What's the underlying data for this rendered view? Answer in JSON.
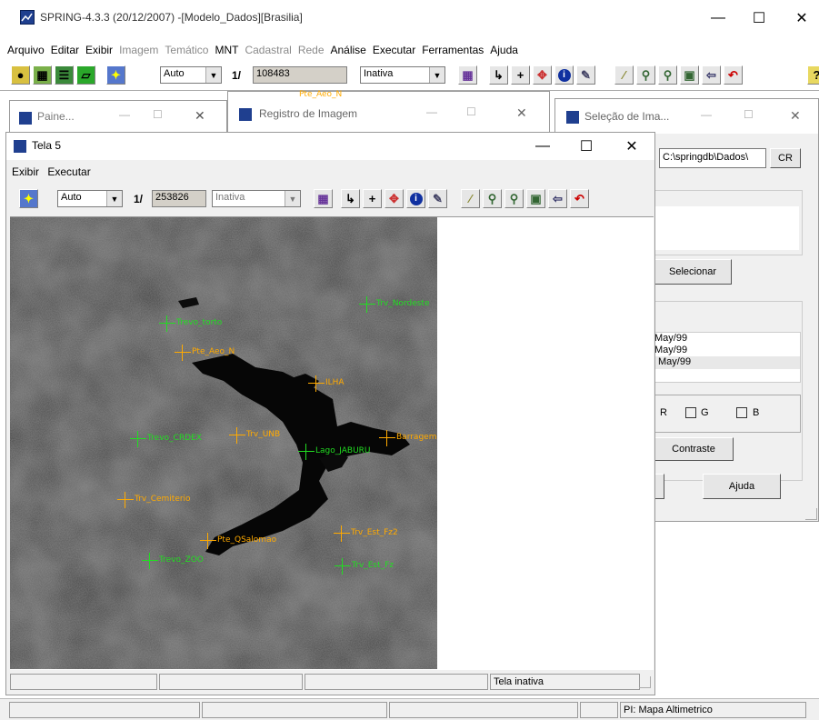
{
  "main_window": {
    "title": "SPRING-4.3.3 (20/12/2007) -[Modelo_Dados][Brasilia]",
    "menu": [
      {
        "label": "Arquivo",
        "enabled": true
      },
      {
        "label": "Editar",
        "enabled": true
      },
      {
        "label": "Exibir",
        "enabled": true
      },
      {
        "label": "Imagem",
        "enabled": false
      },
      {
        "label": "Temático",
        "enabled": false
      },
      {
        "label": "MNT",
        "enabled": true
      },
      {
        "label": "Cadastral",
        "enabled": false
      },
      {
        "label": "Rede",
        "enabled": false
      },
      {
        "label": "Análise",
        "enabled": true
      },
      {
        "label": "Executar",
        "enabled": true
      },
      {
        "label": "Ferramentas",
        "enabled": true
      },
      {
        "label": "Ajuda",
        "enabled": true
      }
    ],
    "toolbar": {
      "zoom_mode": "Auto",
      "scale_prefix": "1/",
      "scale_value": "108483",
      "status": "Inativa"
    },
    "status_bar": {
      "plan_label": "PI: Mapa Altimetrico"
    }
  },
  "painel_window": {
    "title": "Paine..."
  },
  "registro_window": {
    "title": "Registro de Imagem",
    "peek_label": "Pte_Aeo_N"
  },
  "selecao_window": {
    "title": "Seleção de Ima...",
    "path": "C:\\springdb\\Dados\\",
    "cr_button": "CR",
    "select_button": "Selecionar",
    "dates": [
      "May/99",
      "May/99",
      "May/99"
    ],
    "channels": {
      "r": "R",
      "g": "G",
      "b": "B"
    },
    "contrast_button": "Contraste",
    "help_button": "Ajuda"
  },
  "tela5": {
    "title": "Tela 5",
    "menu": [
      "Exibir",
      "Executar"
    ],
    "toolbar": {
      "zoom_mode": "Auto",
      "scale_prefix": "1/",
      "scale_value": "253826",
      "status": "Inativa"
    },
    "status_text": "Tela inativa",
    "markers": [
      {
        "label": "Trv_Nordeste",
        "color": "#22dd22"
      },
      {
        "label": "Trevo_torto",
        "color": "#22dd22"
      },
      {
        "label": "Pte_Aeo_N",
        "color": "#ffaa00"
      },
      {
        "label": "ILHA",
        "color": "#ffaa00"
      },
      {
        "label": "Trevo_CRDEX",
        "color": "#22dd22"
      },
      {
        "label": "Trv_UNB",
        "color": "#ffaa00"
      },
      {
        "label": "Barragem",
        "color": "#ffaa00"
      },
      {
        "label": "Lago_JABURU",
        "color": "#22dd22"
      },
      {
        "label": "Trv_Cemiterio",
        "color": "#ffaa00"
      },
      {
        "label": "Trv_Est_Fz2",
        "color": "#ffaa00"
      },
      {
        "label": "Pte_QSalomao",
        "color": "#ffaa00"
      },
      {
        "label": "Trevo_ZOO",
        "color": "#22dd22"
      },
      {
        "label": "Trv_Est_Fz",
        "color": "#22dd22"
      }
    ]
  }
}
